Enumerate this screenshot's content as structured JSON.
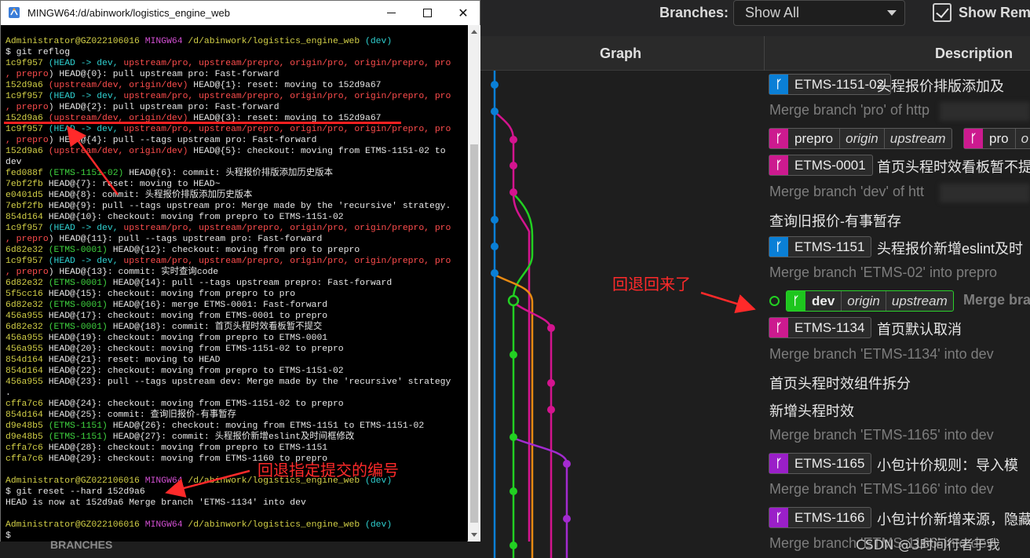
{
  "toolbar": {
    "branches_label": "Branches:",
    "branches_value": "Show All",
    "show_remote_label": "Show Rem",
    "show_remote_checked": true
  },
  "columns": {
    "graph": "Graph",
    "description": "Description"
  },
  "commits": [
    {
      "badges": [
        {
          "color": "blue",
          "name": "ETMS-1151-02",
          "tags": []
        }
      ],
      "message": "头程报价排版添加及",
      "dim": false
    },
    {
      "badges": [],
      "message": "Merge branch 'pro' of http",
      "dim": true
    },
    {
      "badges": [
        {
          "color": "pink",
          "name": "prepro",
          "tags": [
            "origin",
            "upstream"
          ]
        },
        {
          "color": "pink",
          "name": "pro",
          "tags": [
            "o"
          ]
        }
      ],
      "message": "",
      "dim": false
    },
    {
      "badges": [
        {
          "color": "pink",
          "name": "ETMS-0001",
          "tags": []
        }
      ],
      "message": "首页头程时效看板暂不提",
      "dim": false
    },
    {
      "badges": [],
      "message": "Merge branch 'dev' of htt",
      "dim": true
    },
    {
      "badges": [],
      "message": "查询旧报价-有事暂存",
      "dim": false
    },
    {
      "badges": [
        {
          "color": "blue",
          "name": "ETMS-1151",
          "tags": []
        }
      ],
      "message": "头程报价新增eslint及时",
      "dim": false
    },
    {
      "badges": [],
      "message": "Merge branch 'ETMS-02' into prepro",
      "dim": true
    },
    {
      "badges": [
        {
          "color": "green",
          "name": "dev",
          "tags": [
            "origin",
            "upstream"
          ]
        }
      ],
      "message": "Merge bra",
      "dim": true,
      "head": true
    },
    {
      "badges": [
        {
          "color": "pink",
          "name": "ETMS-1134",
          "tags": []
        }
      ],
      "message": "首页默认取消",
      "dim": false
    },
    {
      "badges": [],
      "message": "Merge branch 'ETMS-1134' into dev",
      "dim": true
    },
    {
      "badges": [],
      "message": "首页头程时效组件拆分",
      "dim": false
    },
    {
      "badges": [],
      "message": "新增头程时效",
      "dim": false
    },
    {
      "badges": [],
      "message": "Merge branch 'ETMS-1165' into dev",
      "dim": true
    },
    {
      "badges": [
        {
          "color": "purple",
          "name": "ETMS-1165",
          "tags": []
        }
      ],
      "message": "小包计价规则：导入模",
      "dim": false
    },
    {
      "badges": [],
      "message": "Merge branch 'ETMS-1166' into dev",
      "dim": true
    },
    {
      "badges": [
        {
          "color": "purple",
          "name": "ETMS-1166",
          "tags": []
        }
      ],
      "message": "小包计价新增来源，隐藏",
      "dim": false
    },
    {
      "badges": [],
      "message": "Merge branch 'ETMS-1166' into dev",
      "dim": true
    }
  ],
  "colors": {
    "blue": "#0a7fd6",
    "pink": "#d4148f",
    "green": "#22d022",
    "orange": "#e88a12",
    "purple": "#a32bd0",
    "annotation": "#ff2a2a"
  },
  "terminal": {
    "title": "MINGW64:/d/abinwork/logistics_engine_web",
    "lines": [
      [
        [
          "y",
          "Administrator@GZ022106016 "
        ],
        [
          "m",
          "MINGW64 "
        ],
        [
          "y",
          "/d/abinwork/logistics_engine_web "
        ],
        [
          "c",
          "(dev)"
        ]
      ],
      [
        [
          "w",
          "$ git reflog"
        ]
      ],
      [
        [
          "y",
          "1c9f957 "
        ],
        [
          "c",
          "(HEAD -> dev, "
        ],
        [
          "r",
          "upstream/pro, upstream/prepro, origin/pro, origin/prepro, pro"
        ]
      ],
      [
        [
          "r",
          ", prepro"
        ],
        [
          "w",
          ") HEAD@{0}: pull upstream pro: Fast-forward"
        ]
      ],
      [
        [
          "y",
          "152d9a6 "
        ],
        [
          "r",
          "(upstream/dev, origin/dev)"
        ],
        [
          "w",
          " HEAD@{1}: reset: moving to 152d9a67"
        ]
      ],
      [
        [
          "y",
          "1c9f957 "
        ],
        [
          "c",
          "(HEAD -> dev, "
        ],
        [
          "r",
          "upstream/pro, upstream/prepro, origin/pro, origin/prepro, pro"
        ]
      ],
      [
        [
          "r",
          ", prepro"
        ],
        [
          "w",
          ") HEAD@{2}: pull upstream pro: Fast-forward"
        ]
      ],
      [
        [
          "y",
          "152d9a6 "
        ],
        [
          "r",
          "(upstream/dev, origin/dev)"
        ],
        [
          "w",
          " HEAD@{3}: reset: moving to 152d9a67"
        ]
      ],
      [
        [
          "y",
          "1c9f957 "
        ],
        [
          "c",
          "(HEAD -> dev, "
        ],
        [
          "r",
          "upstream/pro, upstream/prepro, origin/pro, origin/prepro, pro"
        ]
      ],
      [
        [
          "r",
          ", prepro"
        ],
        [
          "w",
          ") HEAD@{4}: pull --tags upstream pro: Fast-forward"
        ]
      ],
      [
        [
          "y",
          "152d9a6 "
        ],
        [
          "r",
          "(upstream/dev, origin/dev)"
        ],
        [
          "w",
          " HEAD@{5}: checkout: moving from ETMS-1151-02 to"
        ]
      ],
      [
        [
          "w",
          "dev"
        ]
      ],
      [
        [
          "y",
          "fed088f "
        ],
        [
          "g",
          "(ETMS-1151-02)"
        ],
        [
          "w",
          " HEAD@{6}: commit: 头程报价排版添加历史版本"
        ]
      ],
      [
        [
          "y",
          "7ebf2fb "
        ],
        [
          "w",
          "HEAD@{7}: reset: moving to HEAD~"
        ]
      ],
      [
        [
          "y",
          "e0401d5 "
        ],
        [
          "w",
          "HEAD@{8}: commit: 头程报价排版添加历史版本"
        ]
      ],
      [
        [
          "y",
          "7ebf2fb "
        ],
        [
          "w",
          "HEAD@{9}: pull --tags upstream pro: Merge made by the 'recursive' strategy."
        ]
      ],
      [
        [
          "y",
          "854d164 "
        ],
        [
          "w",
          "HEAD@{10}: checkout: moving from prepro to ETMS-1151-02"
        ]
      ],
      [
        [
          "y",
          "1c9f957 "
        ],
        [
          "c",
          "(HEAD -> dev, "
        ],
        [
          "r",
          "upstream/pro, upstream/prepro, origin/pro, origin/prepro, pro"
        ]
      ],
      [
        [
          "r",
          ", prepro"
        ],
        [
          "w",
          ") HEAD@{11}: pull --tags upstream pro: Fast-forward"
        ]
      ],
      [
        [
          "y",
          "6d82e32 "
        ],
        [
          "g",
          "(ETMS-0001)"
        ],
        [
          "w",
          " HEAD@{12}: checkout: moving from pro to prepro"
        ]
      ],
      [
        [
          "y",
          "1c9f957 "
        ],
        [
          "c",
          "(HEAD -> dev, "
        ],
        [
          "r",
          "upstream/pro, upstream/prepro, origin/pro, origin/prepro, pro"
        ]
      ],
      [
        [
          "r",
          ", prepro"
        ],
        [
          "w",
          ") HEAD@{13}: commit: 实时查询code"
        ]
      ],
      [
        [
          "y",
          "6d82e32 "
        ],
        [
          "g",
          "(ETMS-0001)"
        ],
        [
          "w",
          " HEAD@{14}: pull --tags upstream prepro: Fast-forward"
        ]
      ],
      [
        [
          "y",
          "5f5cc16 "
        ],
        [
          "w",
          "HEAD@{15}: checkout: moving from prepro to pro"
        ]
      ],
      [
        [
          "y",
          "6d82e32 "
        ],
        [
          "g",
          "(ETMS-0001)"
        ],
        [
          "w",
          " HEAD@{16}: merge ETMS-0001: Fast-forward"
        ]
      ],
      [
        [
          "y",
          "456a955 "
        ],
        [
          "w",
          "HEAD@{17}: checkout: moving from ETMS-0001 to prepro"
        ]
      ],
      [
        [
          "y",
          "6d82e32 "
        ],
        [
          "g",
          "(ETMS-0001)"
        ],
        [
          "w",
          " HEAD@{18}: commit: 首页头程时效看板暂不提交"
        ]
      ],
      [
        [
          "y",
          "456a955 "
        ],
        [
          "w",
          "HEAD@{19}: checkout: moving from prepro to ETMS-0001"
        ]
      ],
      [
        [
          "y",
          "456a955 "
        ],
        [
          "w",
          "HEAD@{20}: checkout: moving from ETMS-1151-02 to prepro"
        ]
      ],
      [
        [
          "y",
          "854d164 "
        ],
        [
          "w",
          "HEAD@{21}: reset: moving to HEAD"
        ]
      ],
      [
        [
          "y",
          "854d164 "
        ],
        [
          "w",
          "HEAD@{22}: checkout: moving from prepro to ETMS-1151-02"
        ]
      ],
      [
        [
          "y",
          "456a955 "
        ],
        [
          "w",
          "HEAD@{23}: pull --tags upstream dev: Merge made by the 'recursive' strategy"
        ]
      ],
      [
        [
          "w",
          "."
        ]
      ],
      [
        [
          "y",
          "cffa7c6 "
        ],
        [
          "w",
          "HEAD@{24}: checkout: moving from ETMS-1151-02 to prepro"
        ]
      ],
      [
        [
          "y",
          "854d164 "
        ],
        [
          "w",
          "HEAD@{25}: commit: 查询旧报价-有事暂存"
        ]
      ],
      [
        [
          "y",
          "d9e48b5 "
        ],
        [
          "g",
          "(ETMS-1151)"
        ],
        [
          "w",
          " HEAD@{26}: checkout: moving from ETMS-1151 to ETMS-1151-02"
        ]
      ],
      [
        [
          "y",
          "d9e48b5 "
        ],
        [
          "g",
          "(ETMS-1151)"
        ],
        [
          "w",
          " HEAD@{27}: commit: 头程报价新增eslint及时间框修改"
        ]
      ],
      [
        [
          "y",
          "cffa7c6 "
        ],
        [
          "w",
          "HEAD@{28}: checkout: moving from prepro to ETMS-1151"
        ]
      ],
      [
        [
          "y",
          "cffa7c6 "
        ],
        [
          "w",
          "HEAD@{29}: checkout: moving from ETMS-1160 to prepro"
        ]
      ],
      [
        [
          "w",
          ""
        ]
      ],
      [
        [
          "y",
          "Administrator@GZ022106016 "
        ],
        [
          "m",
          "MINGW64 "
        ],
        [
          "y",
          "/d/abinwork/logistics_engine_web "
        ],
        [
          "c",
          "(dev)"
        ]
      ],
      [
        [
          "w",
          "$ git reset --hard 152d9a6"
        ]
      ],
      [
        [
          "w",
          "HEAD is now at 152d9a6 Merge branch 'ETMS-1134' into dev"
        ]
      ],
      [
        [
          "w",
          ""
        ]
      ],
      [
        [
          "y",
          "Administrator@GZ022106016 "
        ],
        [
          "m",
          "MINGW64 "
        ],
        [
          "y",
          "/d/abinwork/logistics_engine_web "
        ],
        [
          "c",
          "(dev)"
        ]
      ],
      [
        [
          "w",
          "$"
        ]
      ]
    ]
  },
  "annotations": {
    "rolled_back": "回退回来了",
    "reset_to_commit": "回退指定提交的编号"
  },
  "sidebar_peek": "BRANCHES",
  "watermark": "CSDN @3时间行者于我"
}
